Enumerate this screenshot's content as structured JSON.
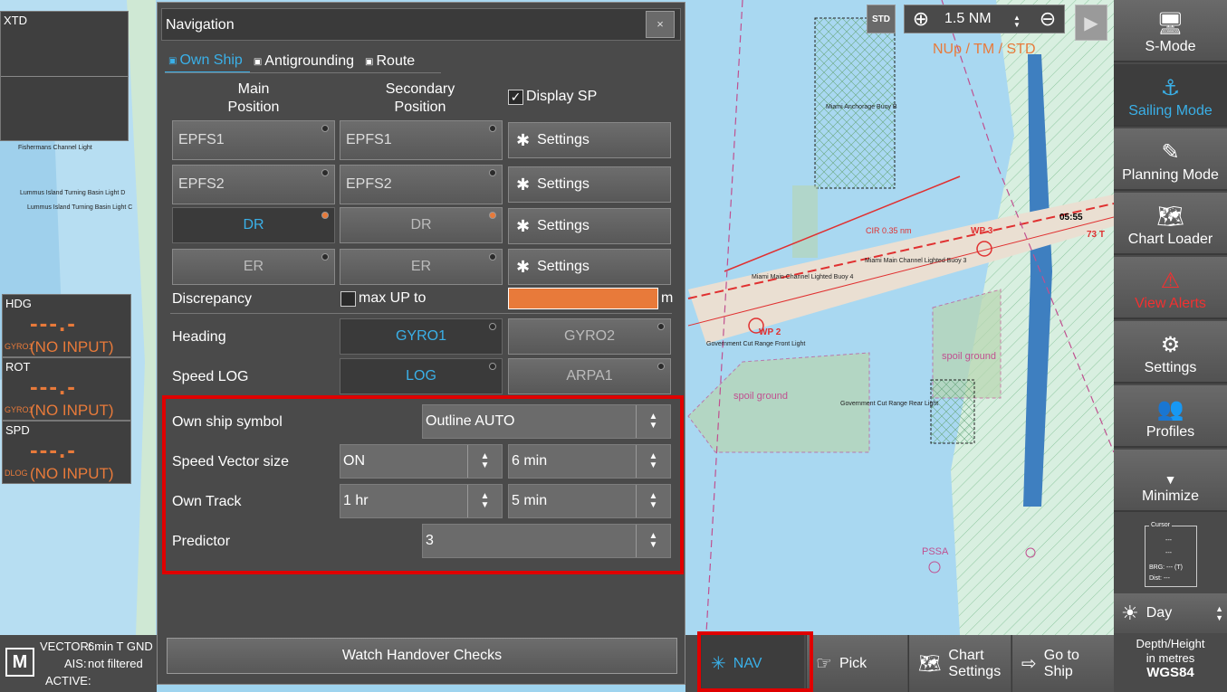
{
  "instruments": {
    "xtd_label": "XTD",
    "hdg": {
      "name": "HDG",
      "value": "---.-",
      "source": "GYRO1",
      "status": "(NO INPUT)"
    },
    "rot": {
      "name": "ROT",
      "value": "---.-",
      "source": "GYRO1",
      "status": "(NO INPUT)"
    },
    "spd": {
      "name": "SPD",
      "value": "---.-",
      "source": "DLOG",
      "status": "(NO INPUT)"
    }
  },
  "chart": {
    "labels": [
      "Fishermans Channel Light",
      "Lummus Island Turning Basin Light D",
      "Lummus Island Turning Basin Light C",
      "Miami Anchorage Buoy B",
      "Miami Main Channel Lighted Buoy 4",
      "Miami Main Channel Lighted Buoy 3",
      "Government Cut Range Front Light",
      "Government Cut Range Rear Light",
      "spoil ground",
      "spoil ground",
      "PSSA",
      "CIR 0.35 nm",
      "WP 3",
      "WP 2",
      "05:55",
      "73 T"
    ],
    "colors": {
      "sea": "#a9d8f1",
      "land": "#d8efe0",
      "orange": "#e87a3a",
      "magenta": "#c05090",
      "route": "#e03030"
    }
  },
  "dialog": {
    "title": "Navigation",
    "close_icon": "×",
    "tabs": [
      {
        "label": "Own Ship",
        "icon": "monitor-icon"
      },
      {
        "label": "Antigrounding",
        "icon": "monitor-icon"
      },
      {
        "label": "Route",
        "icon": "monitor-icon"
      }
    ],
    "col_main": "Main Position",
    "col_secondary": "Secondary Position",
    "display_sp_label": "Display SP",
    "position_sources": [
      {
        "main": "EPFS1",
        "secondary": "EPFS1",
        "settings": "Settings"
      },
      {
        "main": "EPFS2",
        "secondary": "EPFS2",
        "settings": "Settings"
      },
      {
        "main": "DR",
        "secondary": "DR",
        "settings": "Settings"
      },
      {
        "main": "ER",
        "secondary": "ER",
        "settings": "Settings"
      }
    ],
    "discrepancy_label": "Discrepancy",
    "max_up_label": "max UP to",
    "unit_m": "m",
    "heading_label": "Heading",
    "heading_options": [
      "GYRO1",
      "GYRO2"
    ],
    "speed_log_label": "Speed LOG",
    "speed_log_options": [
      "LOG",
      "ARPA1"
    ],
    "own_ship_symbol_label": "Own ship symbol",
    "own_ship_symbol_value": "Outline AUTO",
    "speed_vector_label": "Speed Vector size",
    "speed_vector_mode": "ON",
    "speed_vector_time": "6 min",
    "own_track_label": "Own Track",
    "own_track_length": "1 hr",
    "own_track_interval": "5 min",
    "predictor_label": "Predictor",
    "predictor_value": "3",
    "watch_button": "Watch Handover Checks"
  },
  "toolbar": {
    "std_label": "STD",
    "range": "1.5 NM",
    "mode_text": "NUp / TM / STD"
  },
  "sidebar": {
    "items": [
      {
        "label": "S-Mode",
        "icon": "monitor-icon"
      },
      {
        "label": "Sailing Mode",
        "icon": "ship-wheel-icon"
      },
      {
        "label": "Planning Mode",
        "icon": "planning-icon"
      },
      {
        "label": "Chart Loader",
        "icon": "chart-icon"
      },
      {
        "label": "View Alerts",
        "icon": "alert-icon"
      },
      {
        "label": "Settings",
        "icon": "gear-icon"
      },
      {
        "label": "Profiles",
        "icon": "profiles-icon"
      },
      {
        "label": "Minimize",
        "icon": "chevron-down-icon"
      }
    ],
    "cursor": {
      "title": "Cursor",
      "line1": "---",
      "line2": "---",
      "brg": "BRG: --- (T)",
      "dist": "Dist: ---"
    },
    "day_label": "Day",
    "depth_line1": "Depth/Height",
    "depth_line2": "in metres",
    "datum": "WGS84"
  },
  "status": {
    "vector_label": "VECTOR:",
    "vector_value": "6min T GND",
    "ais_label": "AIS:",
    "ais_value": "not filtered",
    "active_label": "ACTIVE:",
    "m_icon": "M"
  },
  "bottom": {
    "nav": "NAV",
    "pick": "Pick",
    "chart_settings_1": "Chart",
    "chart_settings_2": "Settings",
    "goto_1": "Go to",
    "goto_2": "Ship"
  }
}
